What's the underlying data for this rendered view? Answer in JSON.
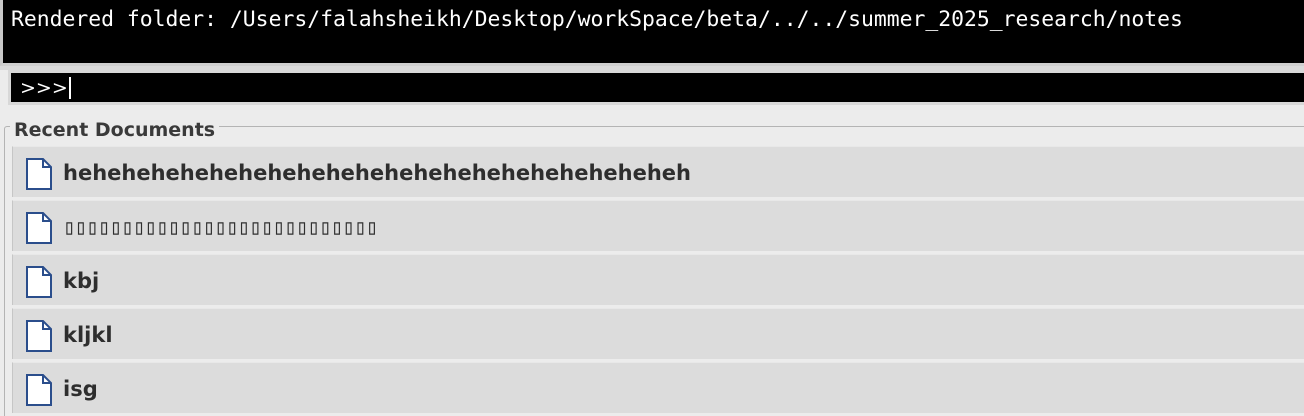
{
  "output": {
    "text": "Rendered folder: /Users/falahsheikh/Desktop/workSpace/beta/../../summer_2025_research/notes"
  },
  "command": {
    "prompt": ">>>",
    "value": ""
  },
  "recent": {
    "title": "Recent Documents",
    "items": [
      {
        "label": "heheheheheheheheheheheheheheheheheheheheheh",
        "icon": "document-icon"
      },
      {
        "label": "▯▯▯▯▯▯▯▯▯▯▯▯▯▯▯▯▯▯▯▯▯▯▯▯▯▯▯",
        "icon": "document-icon"
      },
      {
        "label": "kbj",
        "icon": "document-icon"
      },
      {
        "label": "kljkl",
        "icon": "document-icon"
      },
      {
        "label": "isg",
        "icon": "document-icon"
      }
    ]
  }
}
